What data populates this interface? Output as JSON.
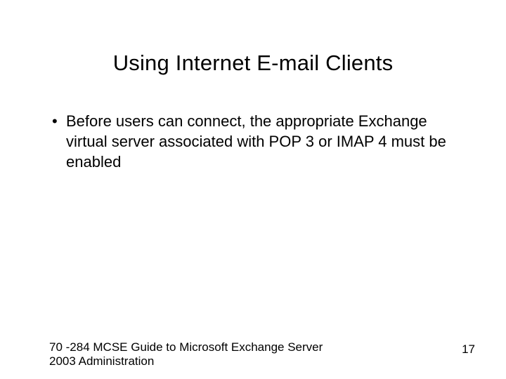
{
  "title": "Using Internet E-mail Clients",
  "bullets": [
    {
      "marker": "•",
      "text": "Before users can connect, the appropriate Exchange virtual server associated with POP 3 or IMAP 4 must be enabled"
    }
  ],
  "footer": {
    "left": "70 -284 MCSE Guide to Microsoft Exchange Server 2003 Administration",
    "page": "17"
  }
}
